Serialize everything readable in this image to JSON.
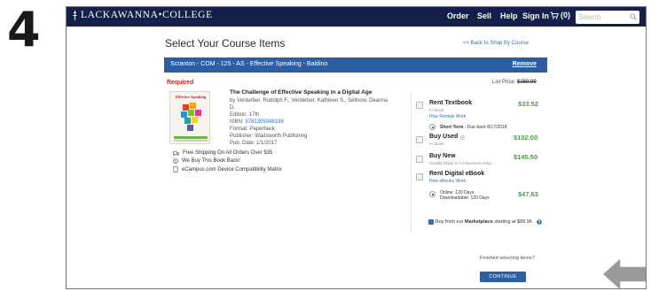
{
  "step_number": "4",
  "nav": {
    "brand": "LACKAWANNA•COLLEGE",
    "items": [
      "Order",
      "Sell",
      "Help",
      "Sign In"
    ],
    "cart_count": "(0)",
    "search_placeholder": "Search"
  },
  "page": {
    "title": "Select Your Course Items",
    "back_link": "<< Back to Shop By Course"
  },
  "course": {
    "title": "Scranton - COM - 125 - AS - Effective Speaking - Baldino",
    "remove": "Remove",
    "required": "Required",
    "list_price_label": "List Price:",
    "list_price": "$150.00"
  },
  "book": {
    "cover_title": "Effective Speaking",
    "title": "The Challenge of Effective Speaking in a Digital Age",
    "authors_line1": "by Verderber, Rudolph F., Verderber, Kathleen S., Sellnow, Deanna",
    "authors_line2": "D.",
    "edition": "Edition: 17th",
    "isbn_label": "ISBN: ",
    "isbn": "9781305948198",
    "format": "Format: Paperback",
    "publisher": "Publisher: Wadsworth Publishing",
    "pub_date": "Pub. Date: 1/1/2017"
  },
  "perks": [
    "Free Shipping On All Orders Over $35",
    "We Buy This Book Back!",
    "eCampus.com Device Compatibility Matrix"
  ],
  "options": {
    "rent_textbook": {
      "label": "Rent Textbook",
      "stock": "In Stock",
      "link": "How Rentals Work",
      "price": "$33.52",
      "term_bold": "Short Term",
      "term_rest": " - Due back 8/17/2018"
    },
    "buy_used": {
      "label": "Buy Used",
      "stock": "In Stock",
      "price": "$102.00"
    },
    "buy_new": {
      "label": "Buy New",
      "stock": "Usually Ships in 2-3 Business Days",
      "price": "$145.50"
    },
    "ebook": {
      "label": "Rent Digital eBook",
      "link": "How eBooks Work",
      "online": "Online: 120 Days",
      "download": "Downloadable: 120 Days",
      "price": "$47.63"
    }
  },
  "marketplace": {
    "prefix": "Buy from our ",
    "bold": "Marketplace",
    "suffix": " starting at $89.96"
  },
  "footer": {
    "finished": "Finished selecting items?",
    "continue": "CONTINUE"
  },
  "colors": {
    "nav_bg": "#12204a",
    "accent_blue": "#2c5ea3",
    "price_green": "#3aa635",
    "required_red": "#c8251f"
  }
}
